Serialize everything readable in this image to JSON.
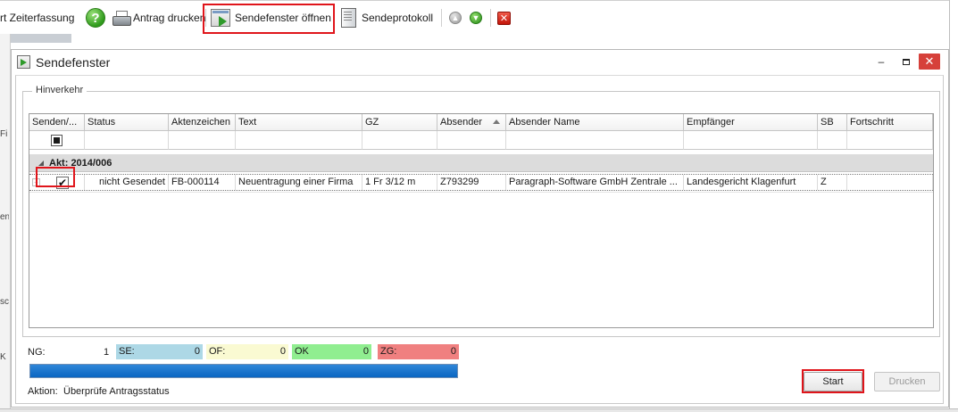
{
  "toolbar": {
    "zeiterfassung_label": "rt Zeiterfassung",
    "help_glyph": "?",
    "antrag_label": "Antrag drucken",
    "sendefenster_label": "Sendefenster öffnen",
    "sendeprotokoll_label": "Sendeprotokoll",
    "up_glyph": "▲",
    "down_glyph": "▼",
    "close_glyph": "✕"
  },
  "background_fragments": [
    "Fi",
    "en",
    "sc",
    "K"
  ],
  "dialog": {
    "title": "Sendefenster",
    "minimize_glyph": "–",
    "close_glyph": "✕",
    "group_label": "Hinverkehr",
    "columns": [
      "Senden/...",
      "Status",
      "Aktenzeichen",
      "Text",
      "GZ",
      "Absender",
      "Absender Name",
      "Empfänger",
      "SB",
      "Fortschritt"
    ],
    "sorted_column": "Absender",
    "group_row": "Akt: 2014/006",
    "rows": [
      {
        "checked": true,
        "check_glyph": "✔",
        "status": "nicht Gesendet",
        "aktenzeichen": "FB-000114",
        "text": "Neuentragung einer Firma",
        "gz": "1 Fr 3/12 m",
        "absender": "Z793299",
        "absender_name": "Paragraph-Software GmbH Zentrale ...",
        "empfaenger": "Landesgericht Klagenfurt",
        "sb": "Z",
        "fortschritt": ""
      }
    ],
    "stats": {
      "ng_label": "NG:",
      "ng_value": "1",
      "se_label": "SE:",
      "se_value": "0",
      "of_label": "OF:",
      "of_value": "0",
      "ok_label": "OK",
      "ok_value": "0",
      "zg_label": "ZG:",
      "zg_value": "0"
    },
    "colors": {
      "se": "#add8e6",
      "of": "#fafad2",
      "ok": "#90ee90",
      "zg": "#f08080",
      "progress": "#0a66c2",
      "highlight": "#e0151b"
    },
    "progress_fraction": 1.0,
    "action_label": "Aktion:",
    "action_text": "Überprüfe Antragsstatus",
    "start_label": "Start",
    "drucken_label": "Drucken"
  }
}
